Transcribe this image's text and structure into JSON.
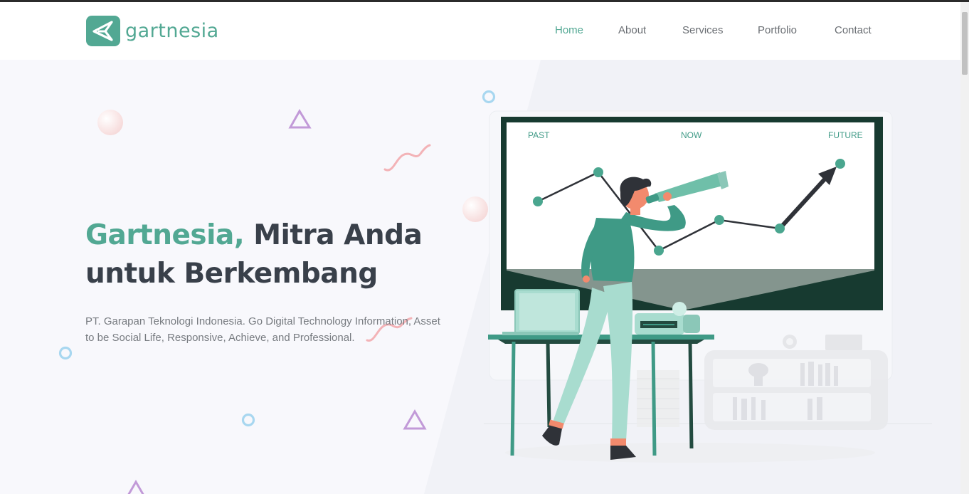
{
  "brand": {
    "name": "gartnesia",
    "icon": "paper-plane-logo-icon"
  },
  "nav": {
    "items": [
      {
        "label": "Home",
        "active": true
      },
      {
        "label": "About",
        "active": false
      },
      {
        "label": "Services",
        "active": false
      },
      {
        "label": "Portfolio",
        "active": false
      },
      {
        "label": "Contact",
        "active": false
      }
    ]
  },
  "hero": {
    "title_accent": "Gartnesia,",
    "title_rest_line1": " Mitra Anda",
    "title_line2": "untuk Berkembang",
    "description": "PT. Garapan Teknologi Indonesia. Go Digital Technology Information, Asset to be Social Life, Responsive, Achieve, and Professional."
  },
  "illustration": {
    "board_labels": {
      "past": "PAST",
      "now": "NOW",
      "future": "FUTURE"
    }
  },
  "colors": {
    "accent": "#52a893",
    "dark_text": "#39404a",
    "muted_text": "#777b80"
  }
}
